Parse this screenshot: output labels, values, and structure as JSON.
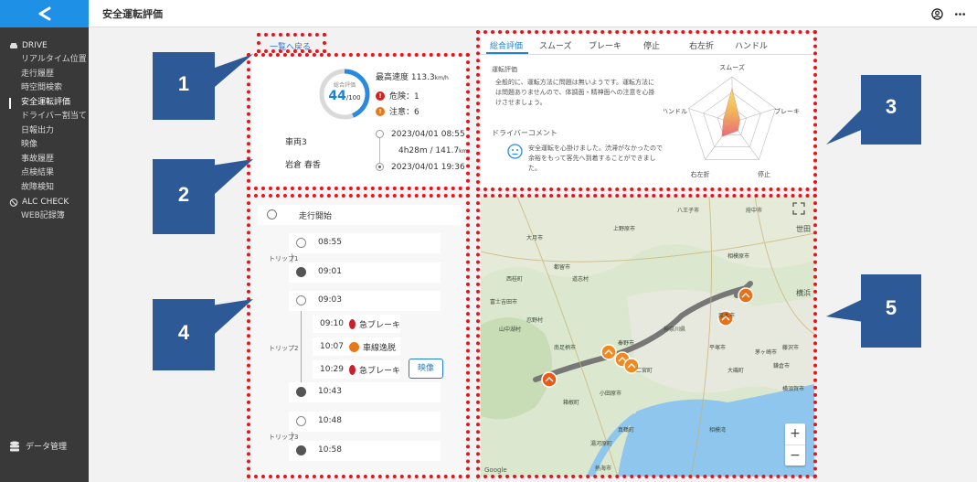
{
  "sidebar": {
    "items": [
      {
        "label": "リアルタイム位置"
      },
      {
        "label": "走行履歴"
      },
      {
        "label": "時空間検索"
      },
      {
        "label": "安全運転評価"
      },
      {
        "label": "ドライバー割当て"
      },
      {
        "label": "日報出力"
      },
      {
        "label": "映像"
      },
      {
        "label": "事故履歴"
      },
      {
        "label": "点検結果"
      },
      {
        "label": "故障検知"
      }
    ],
    "drive_label": "DRIVE",
    "alc_label": "ALC CHECK",
    "web_label": "WEB記録簿",
    "data_label": "データ管理"
  },
  "header": {
    "title": "安全運転評価"
  },
  "back_link": "一覧へ戻る",
  "summary": {
    "score_label": "総合評価",
    "score": "44",
    "score_max": "/100",
    "max_speed": "最高速度 113.3",
    "speed_unit": "km/h",
    "danger": "危険：1",
    "caution": "注意：6",
    "vehicle": "車両3",
    "driver": "岩倉 春香",
    "start_time": "2023/04/01 08:55",
    "duration": "4h28m / 141.7",
    "distance_unit": "km",
    "end_time": "2023/04/01 19:36"
  },
  "eval_panel": {
    "tabs": [
      "総合評価",
      "スムーズ",
      "ブレーキ",
      "停止",
      "右左折",
      "ハンドル"
    ],
    "eval_title": "運転評価",
    "eval_text": "全般的に、運転方法に問題は無いようです。運転方法には問題ありませんので、体調面・精神面への注意を心掛けさせましょう。",
    "comment_title": "ドライバーコメント",
    "comment_text": "安全運転を心掛けました。渋滞がなかったので余裕をもって客先へ到着することができました。",
    "radar_labels": {
      "top": "スムーズ",
      "right": "ブレーキ",
      "bottom_right": "停止",
      "bottom_left": "右左折",
      "left": "ハンドル"
    },
    "radar_values": {
      "smooth": 0.75,
      "brake": 0.18,
      "stop": 0.22,
      "turn": 0.38,
      "handle": 0.2
    }
  },
  "timeline": {
    "start_label": "走行開始",
    "trips": [
      {
        "label": "トリップ1",
        "start": "08:55",
        "end": "09:01"
      },
      {
        "label": "トリップ2",
        "start": "09:03",
        "end": "10:43"
      },
      {
        "label": "トリップ3",
        "start": "10:48",
        "end": "10:58"
      }
    ],
    "events": [
      {
        "time": "09:10",
        "label": "急ブレーキ"
      },
      {
        "time": "10:07",
        "label": "車線逸脱"
      },
      {
        "time": "10:29",
        "label": "急ブレーキ"
      }
    ],
    "video_button": "映像"
  },
  "map": {
    "labels": [
      "八王子市",
      "府中市",
      "上野原市",
      "大月市",
      "相模原市",
      "都留市",
      "道志村",
      "西桂町",
      "富士吉田市",
      "山中湖村",
      "忍野村",
      "厚木市",
      "神奈川県",
      "秦野市",
      "平塚市",
      "大磯町",
      "二宮町",
      "南足柄市",
      "小田原市",
      "箱根町",
      "真鶴町",
      "湯河原町",
      "熱海市",
      "茅ヶ崎市",
      "藤沢市",
      "鎌倉市",
      "横須賀市",
      "横浜",
      "相模湾",
      "世田"
    ],
    "google": "Google"
  },
  "callouts": [
    "1",
    "2",
    "3",
    "4",
    "5"
  ]
}
